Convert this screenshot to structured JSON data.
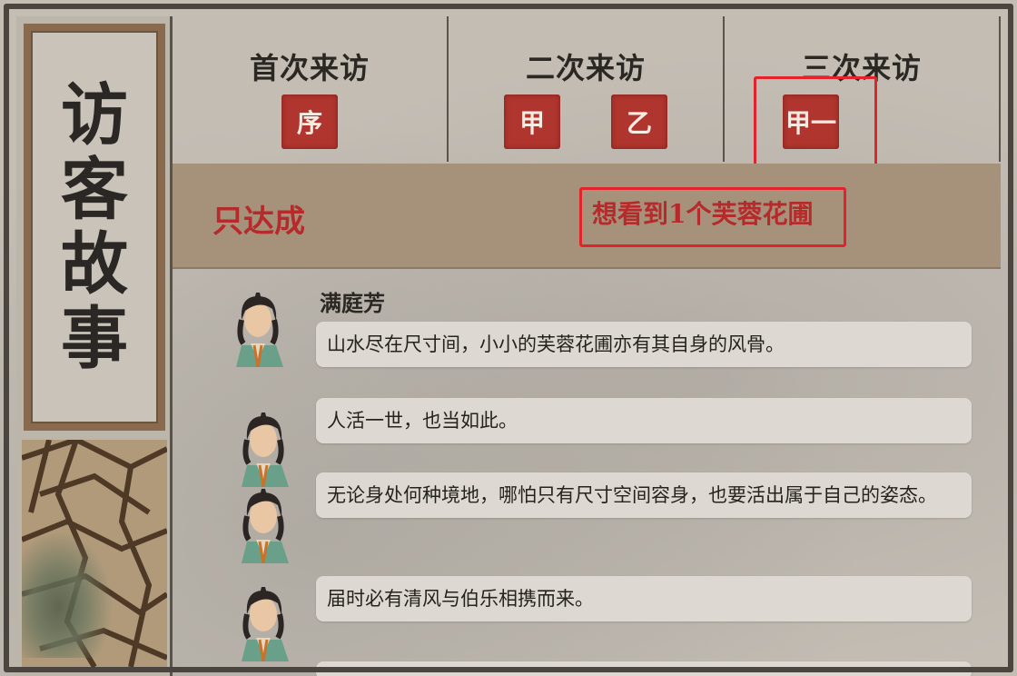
{
  "panel": {
    "title_chars": [
      "访",
      "客",
      "故",
      "事"
    ]
  },
  "visits": [
    {
      "label": "首次来访",
      "tags": [
        "序"
      ]
    },
    {
      "label": "二次来访",
      "tags": [
        "甲",
        "乙"
      ]
    },
    {
      "label": "三次来访",
      "tags": [
        "甲一"
      ]
    }
  ],
  "condition": {
    "label": "只达成",
    "requirement": "想看到1个芙蓉花圃"
  },
  "dialogue": {
    "speaker": "满庭芳",
    "lines": [
      "山水尽在尺寸间，小小的芙蓉花圃亦有其自身的风骨。",
      "人活一世，也当如此。",
      "无论身处何种境地，哪怕只有尺寸空间容身，也要活出属于自己的姿态。",
      "届时必有清风与伯乐相携而来。"
    ]
  },
  "colors": {
    "seal_red": "#b0352e",
    "highlight": "#e2232c",
    "condition_text": "#b52a2a",
    "band": "#a6927b"
  }
}
